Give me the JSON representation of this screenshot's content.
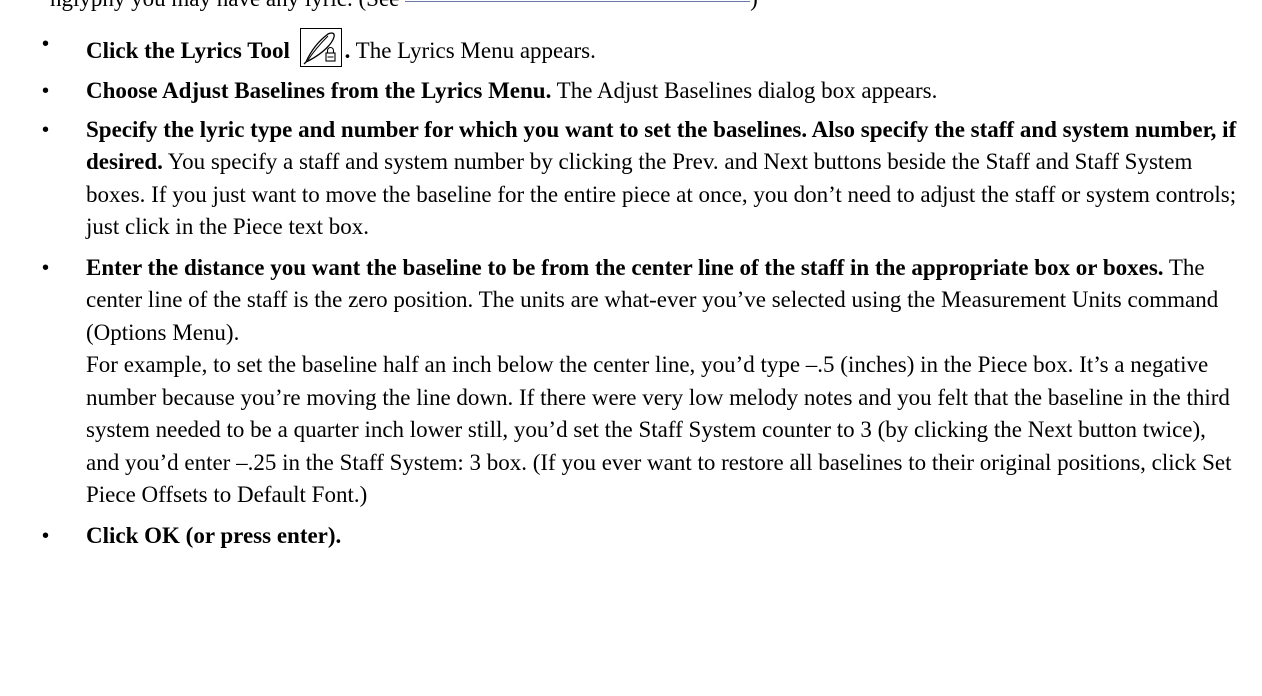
{
  "intro_line": {
    "text": "nglyphy you may have any lyric. (See"
  },
  "steps": [
    {
      "bullet": "•",
      "bold": "Click the Lyrics Tool",
      "bold_after_icon": ".",
      "normal": " The Lyrics Menu appears.",
      "icon": "lyrics-tool-pen-icon"
    },
    {
      "bullet": "•",
      "bold": "Choose Adjust Baselines from the Lyrics Menu.",
      "normal": " The Adjust Baselines dialog box appears."
    },
    {
      "bullet": "•",
      "bold": "Specify the lyric type and number for which you want to set the baselines. Also specify the staff and system number, if desired.",
      "normal": " You specify a staff and system number by clicking the Prev. and Next buttons beside the Staff and Staff System boxes. If you just want to move the baseline for the entire piece at once, you don’t need to adjust the staff or system controls; just click in the Piece text box."
    },
    {
      "bullet": "•",
      "bold": "Enter the distance you want the baseline to be from the center line of the staff in the appropriate box or boxes.",
      "normal": " The center line of the staff is the zero position. The units are what-ever you’ve selected using the Measurement Units command (Options Menu).",
      "extra_paragraph": "For example, to set the baseline half an inch below the center line, you’d type –.5 (inches) in the Piece box. It’s a negative number because you’re moving the line down. If there were very low melody notes and you felt that the baseline in the third system needed to be a quarter inch lower still, you’d set the Staff System counter to 3 (by clicking the Next button twice), and you’d enter –.25 in the Staff System: 3 box. (If you ever want to restore all baselines to their original positions, click Set Piece Offsets to Default Font.)"
    },
    {
      "bullet": "•",
      "bold": "Click OK (or press enter).",
      "normal": ""
    }
  ]
}
